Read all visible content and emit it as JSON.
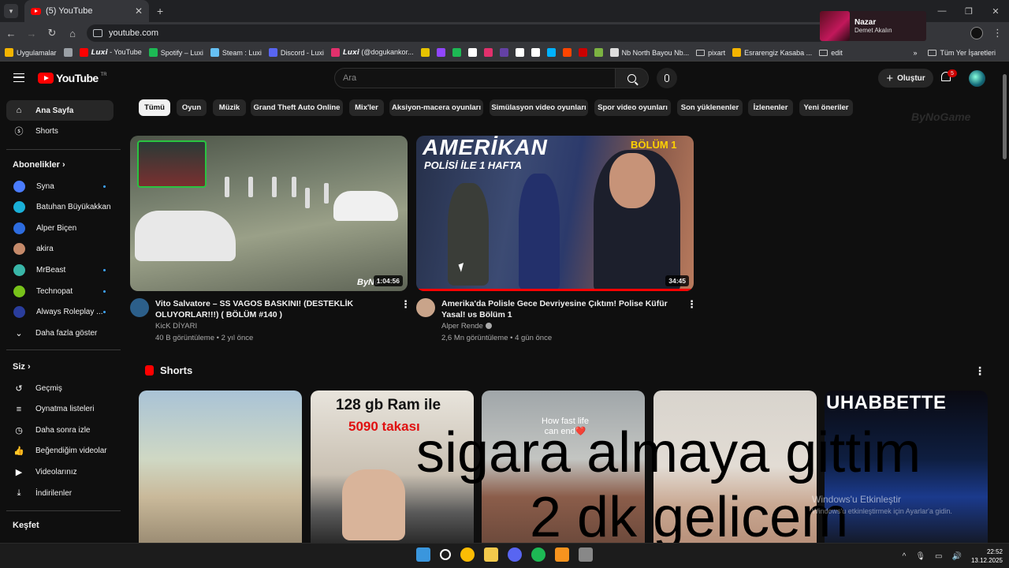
{
  "browser": {
    "tab_title": "(5) YouTube",
    "url": "youtube.com",
    "bookmarks": [
      {
        "label": "Uygulamalar",
        "color": "#f4b400"
      },
      {
        "label": "",
        "color": "#9aa0a6"
      },
      {
        "label": "𝙇𝙪𝙭𝙞 - YouTube",
        "color": "#ff0000"
      },
      {
        "label": "Spotify – Luxi",
        "color": "#1db954"
      },
      {
        "label": "Steam : Luxi",
        "color": "#66c0f4"
      },
      {
        "label": "Discord - Luxi",
        "color": "#5865f2"
      },
      {
        "label": "𝙇𝙪𝙭𝙞 (@dogukankor...",
        "color": "#e1306c"
      }
    ],
    "bookmark_icons": [
      "#e6c200",
      "#9146ff",
      "#1db954",
      "#ffffff",
      "#e1306c",
      "#6441a5",
      "#ffffff",
      "#ffffff",
      "#00b2ff",
      "#ff4500",
      "#cc0000",
      "#7cb342"
    ],
    "bookmarks_after": [
      {
        "label": "Nb North Bayou Nb...",
        "color": "#dddddd"
      },
      {
        "label": "pixart",
        "color": "folder"
      },
      {
        "label": "Esrarengiz Kasaba ...",
        "color": "#f4b400"
      },
      {
        "label": "edit",
        "color": "folder"
      }
    ],
    "all_bookmarks": "Tüm Yer İşaretleri"
  },
  "now_playing": {
    "title": "Nazar",
    "artist": "Demet Akalın"
  },
  "youtube": {
    "logo_text": "YouTube",
    "logo_sup": "TR",
    "search_placeholder": "Ara",
    "create_label": "Oluştur",
    "notif_count": "5",
    "sidebar": {
      "home": "Ana Sayfa",
      "shorts": "Shorts",
      "subscriptions_title": "Abonelikler",
      "channels": [
        {
          "name": "Syna",
          "color": "#4a7cff",
          "dot": true
        },
        {
          "name": "Batuhan Büyükakkan",
          "color": "#1ab0d8",
          "dot": false
        },
        {
          "name": "Alper Biçen",
          "color": "#2d6cdf",
          "dot": false
        },
        {
          "name": "akira",
          "color": "#c58a6a",
          "dot": false
        },
        {
          "name": "MrBeast",
          "color": "#39b6a8",
          "dot": true
        },
        {
          "name": "Technopat",
          "color": "#78c21a",
          "dot": true
        },
        {
          "name": "Always Roleplay ...",
          "color": "#2a3d9c",
          "dot": true
        }
      ],
      "show_more": "Daha fazla göster",
      "you_title": "Siz",
      "you_items": [
        "Geçmiş",
        "Oynatma listeleri",
        "Daha sonra izle",
        "Beğendiğim videolar",
        "Videolarınız",
        "İndirilenler"
      ],
      "explore_title": "Keşfet"
    },
    "chips": [
      "Tümü",
      "Oyun",
      "Müzik",
      "Grand Theft Auto Online",
      "Mix'ler",
      "Aksiyon-macera oyunları",
      "Simülasyon video oyunları",
      "Spor video oyunları",
      "Son yüklenenler",
      "İzlenenler",
      "Yeni öneriler"
    ],
    "watermark": "ByNoGame",
    "videos": [
      {
        "title": "Vito Salvatore – SS VAGOS BASKINI! (DESTEKLİK OLUYORLAR!!!) ( BÖLÜM #140 )",
        "channel": "KicK DİYARI",
        "meta": "40 B görüntüleme • 2 yıl önce",
        "duration": "1:04:56",
        "thumb_label": "ByNo",
        "avatar_color": "#2c5f8a",
        "progress_fraction": 0
      },
      {
        "title": "Amerika'da Polisle Gece Devriyesine Çıktım! Polise Küfür Yasal! ᴜs Bölüm 1",
        "channel": "Alper Rende",
        "meta": "2,6 Mn görüntüleme • 4 gün önce",
        "duration": "34:45",
        "thumb_title": "AMERİKAN",
        "thumb_subtitle": "POLİSİ İLE 1 HAFTA",
        "thumb_episode": "BÖLÜM 1",
        "avatar_color": "#c9a48a",
        "progress_fraction": 1
      }
    ],
    "shorts_title": "Shorts",
    "shorts": [
      {
        "text": ""
      },
      {
        "text": "128 gb Ram ile",
        "text2": "5090 takası"
      },
      {
        "text": "How fast life can end❤️"
      },
      {
        "text": ""
      },
      {
        "text": "UHABBETTE"
      }
    ]
  },
  "overlay": {
    "line1": "sigara almaya gittim",
    "line2": "2 dk gelicem"
  },
  "windows_activation": {
    "title": "Windows'u Etkinleştir",
    "subtitle": "Windows'u etkinleştirmek için Ayarlar'a gidin."
  },
  "taskbar": {
    "time": "22:52",
    "date": "13.12.2025",
    "apps": [
      "#3a96dd",
      "#ffffff",
      "#fbbc04",
      "#f2c94c",
      "#5865f2",
      "#1db954",
      "#f7931e",
      "#888888"
    ]
  }
}
